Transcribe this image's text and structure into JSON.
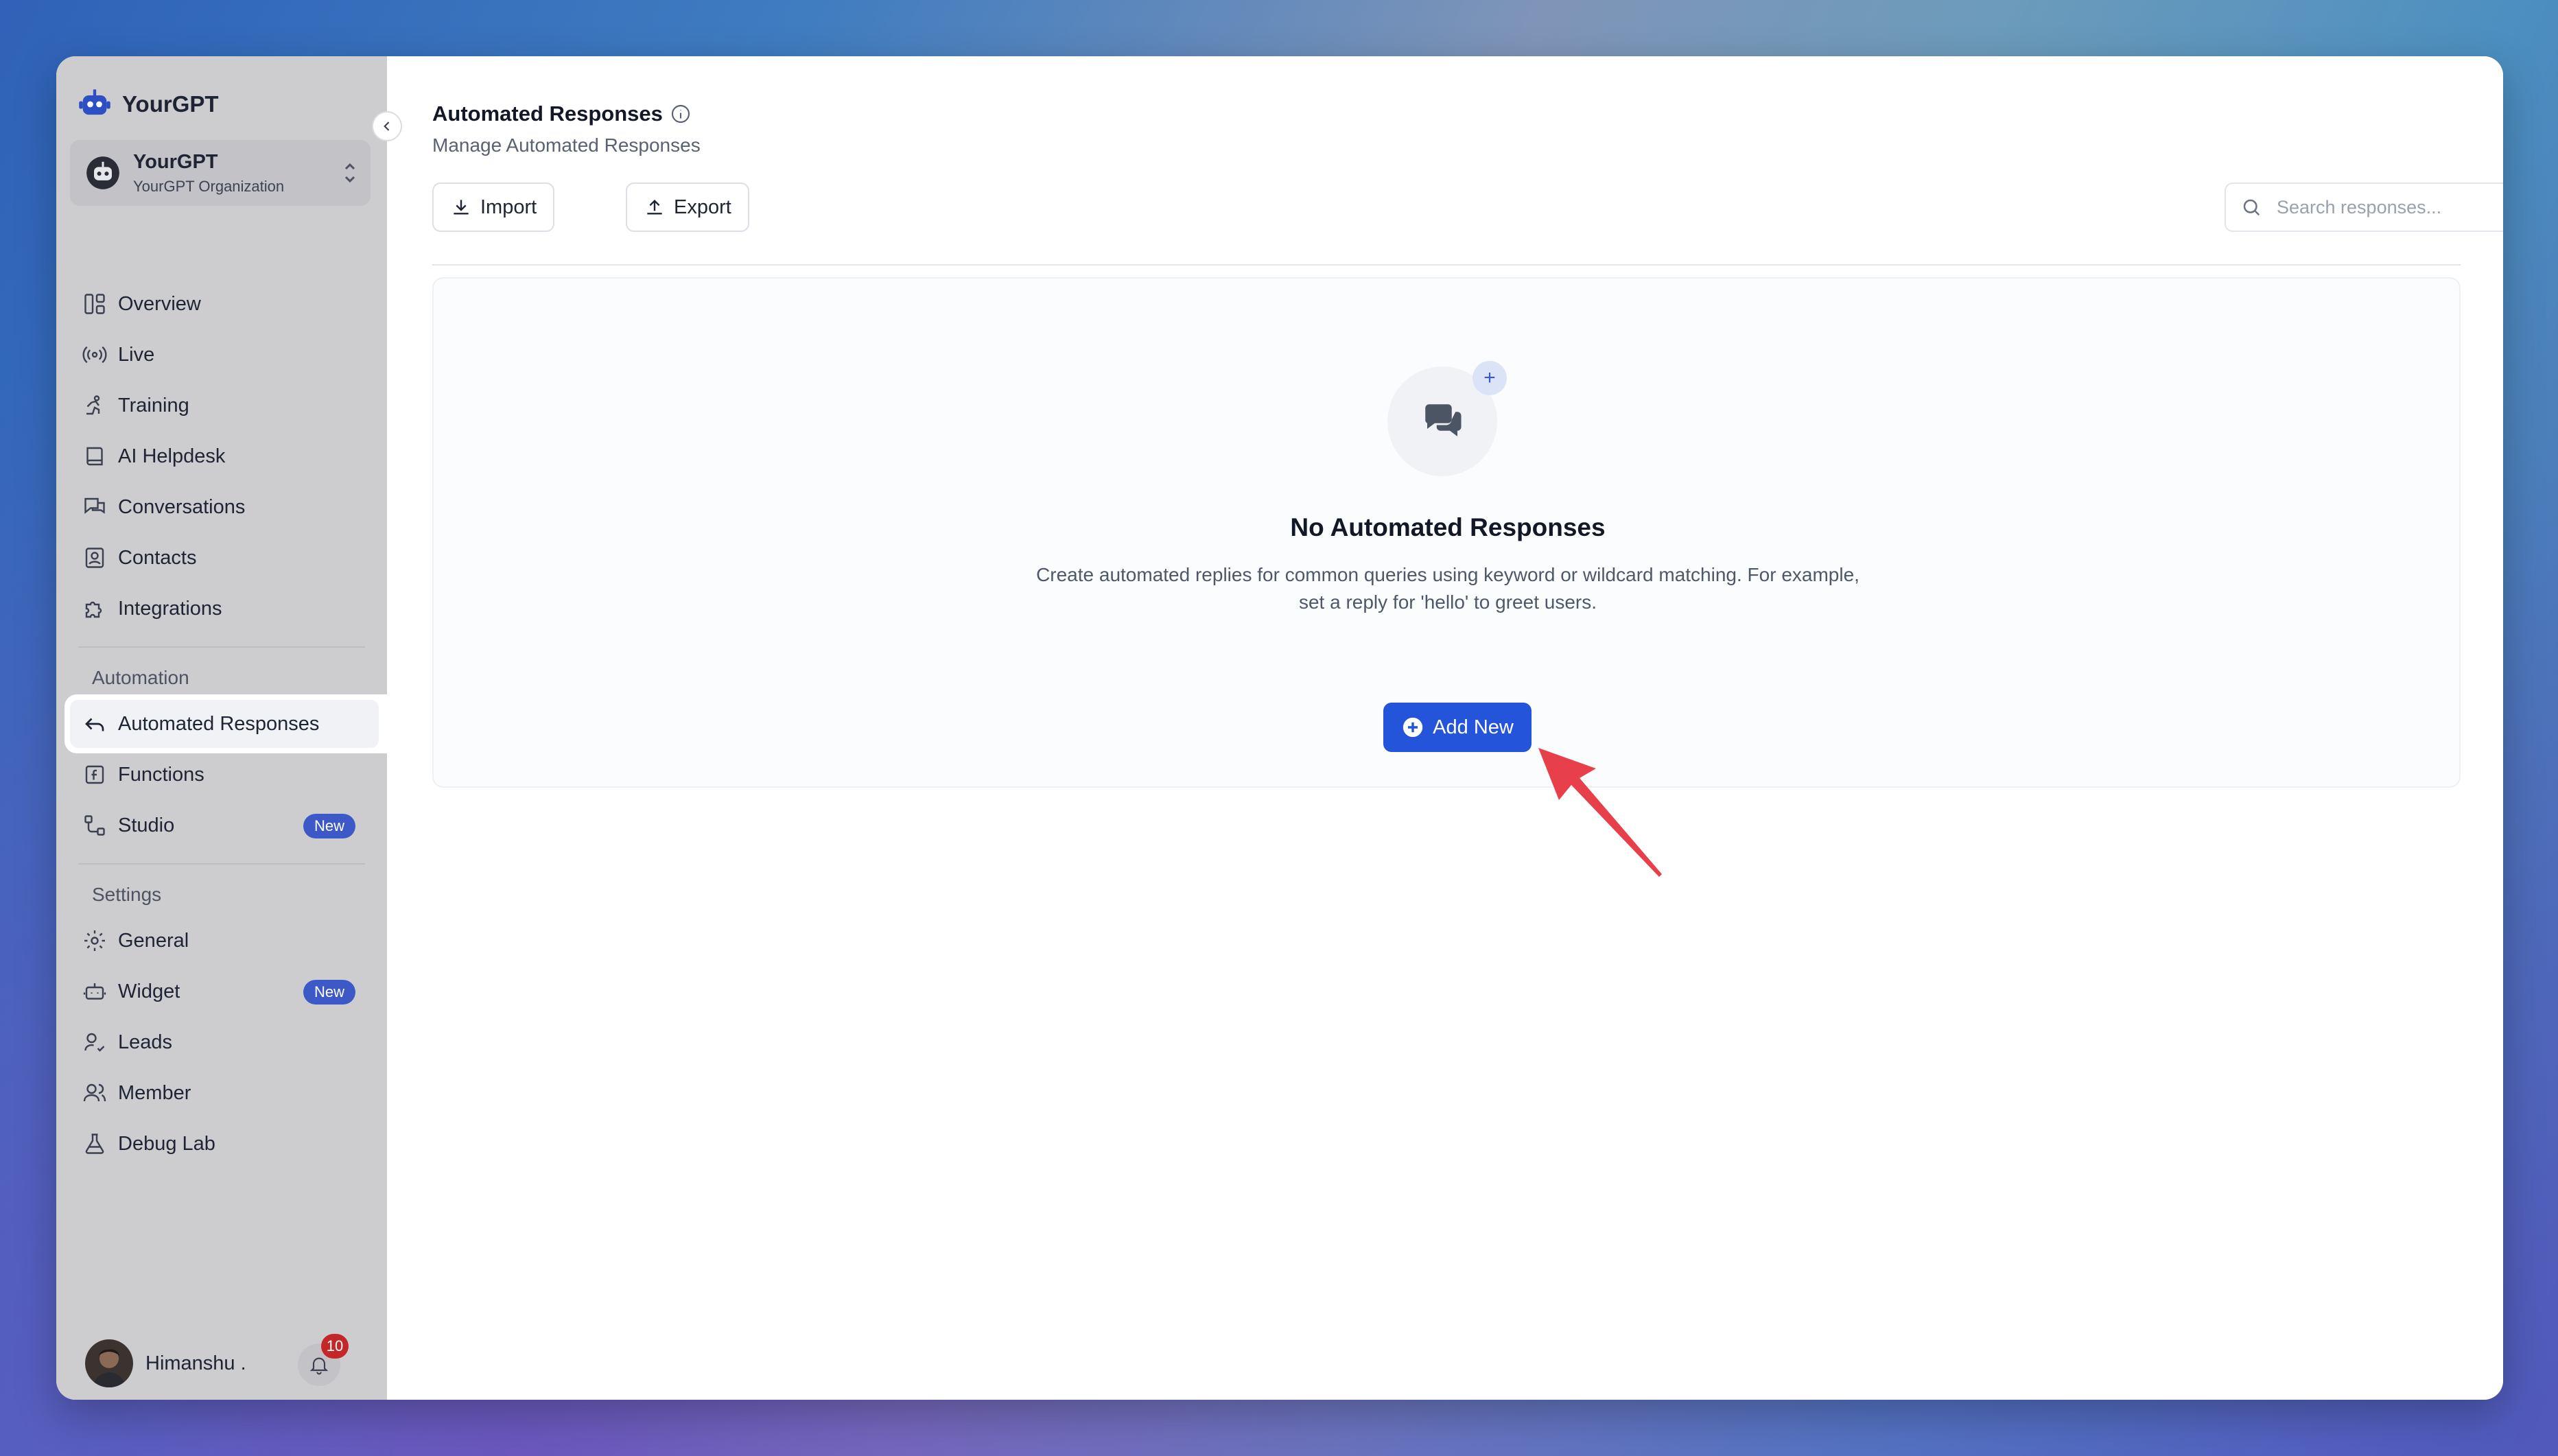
{
  "sidebar": {
    "brand": "YourGPT",
    "org": {
      "name": "YourGPT",
      "subtitle": "YourGPT Organization"
    },
    "main_items": [
      {
        "label": "Overview",
        "icon": "layout-icon"
      },
      {
        "label": "Live",
        "icon": "broadcast-icon"
      },
      {
        "label": "Training",
        "icon": "training-icon"
      },
      {
        "label": "AI Helpdesk",
        "icon": "book-icon"
      },
      {
        "label": "Conversations",
        "icon": "chat-icon"
      },
      {
        "label": "Contacts",
        "icon": "contact-card-icon"
      },
      {
        "label": "Integrations",
        "icon": "puzzle-icon"
      }
    ],
    "automation": {
      "section": "Automation",
      "items": [
        {
          "label": "Automated Responses",
          "icon": "reply-icon"
        },
        {
          "label": "Functions",
          "icon": "function-icon"
        },
        {
          "label": "Studio",
          "icon": "workflow-icon",
          "badge": "New"
        }
      ]
    },
    "settings": {
      "section": "Settings",
      "items": [
        {
          "label": "General",
          "icon": "gear-icon"
        },
        {
          "label": "Widget",
          "icon": "bot-icon",
          "badge": "New"
        },
        {
          "label": "Leads",
          "icon": "user-check-icon"
        },
        {
          "label": "Member",
          "icon": "users-icon"
        },
        {
          "label": "Debug Lab",
          "icon": "flask-icon"
        }
      ]
    },
    "user": {
      "name": "Himanshu .",
      "notifications": "10"
    }
  },
  "main": {
    "title": "Automated Responses",
    "subtitle": "Manage Automated Responses",
    "import_label": "Import",
    "export_label": "Export",
    "search_placeholder": "Search responses...",
    "empty": {
      "title": "No Automated Responses",
      "description": "Create automated replies for common queries using keyword or wildcard matching. For example, set a reply for 'hello' to greet users.",
      "button": "Add New"
    }
  },
  "colors": {
    "accent": "#2354d9",
    "badge": "#3c59c7",
    "notification": "#c42727",
    "annotation_arrow": "#e8404a"
  }
}
